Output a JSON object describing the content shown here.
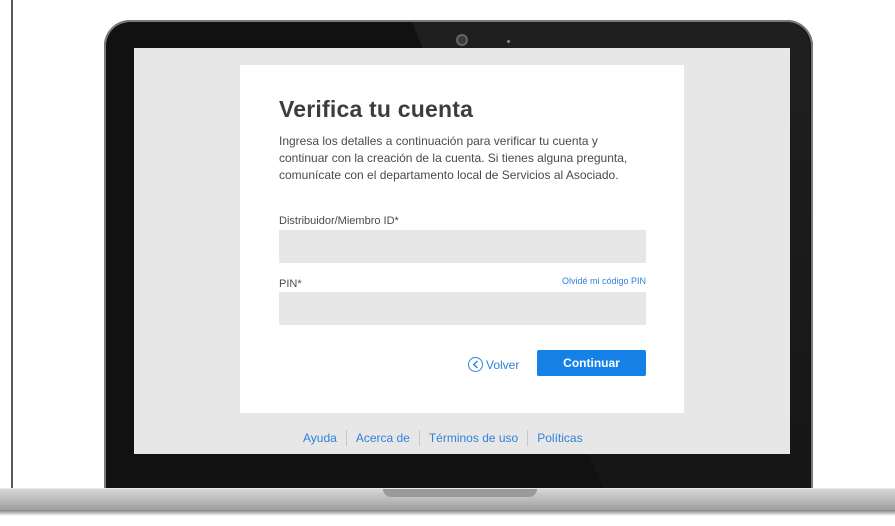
{
  "page": {
    "title": "Verifica tu cuenta",
    "description": "Ingresa los detalles a continuación para verificar tu cuenta y continuar con la creación de la cuenta. Si tienes alguna pregunta, comunícate con el departamento local de Servicios al Asociado."
  },
  "form": {
    "distributor_label": "Distribuidor/Miembro ID*",
    "distributor_value": "",
    "pin_label": "PIN*",
    "pin_value": "",
    "forgot_pin_link": "Olvidé mi código PIN"
  },
  "actions": {
    "back_label": "Volver",
    "continue_label": "Continuar"
  },
  "footer": {
    "links": [
      "Ayuda",
      "Acerca de",
      "Términos de uso",
      "Políticas"
    ]
  },
  "colors": {
    "accent": "#1581e6",
    "link": "#2f82d9",
    "field_bg": "#e7e7e7"
  }
}
